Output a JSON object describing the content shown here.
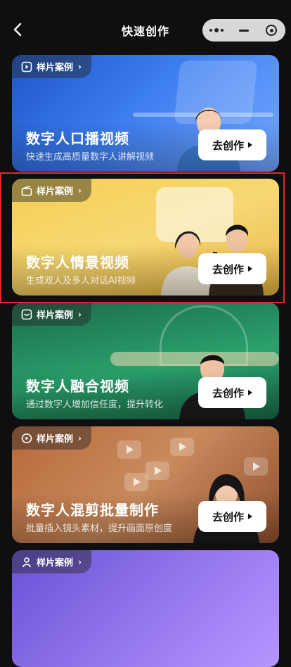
{
  "header": {
    "title": "快速创作"
  },
  "cards": [
    {
      "tag": "样片案例",
      "title": "数字人口播视频",
      "subtitle": "快速生成高质量数字人讲解视频",
      "button": "去创作"
    },
    {
      "tag": "样片案例",
      "title": "数字人情景视频",
      "subtitle": "生成双人及多人对话AI视频",
      "button": "去创作"
    },
    {
      "tag": "样片案例",
      "title": "数字人融合视频",
      "subtitle": "通过数字人增加信任度，提升转化",
      "button": "去创作"
    },
    {
      "tag": "样片案例",
      "title": "数字人混剪批量制作",
      "subtitle": "批量插入镜头素材，提升画面原创度",
      "button": "去创作"
    },
    {
      "tag": "样片案例"
    }
  ],
  "colors": {
    "highlight": "#e3262b",
    "background": "#0f0f11"
  },
  "icons": [
    "back-arrow-icon",
    "more-dots-icon",
    "minimize-icon",
    "close-target-icon",
    "video-play-icon",
    "clapperboard-icon",
    "checkbox-icon",
    "copy-video-icon",
    "person-icon",
    "chevron-right-icon",
    "play-triangle-icon"
  ]
}
